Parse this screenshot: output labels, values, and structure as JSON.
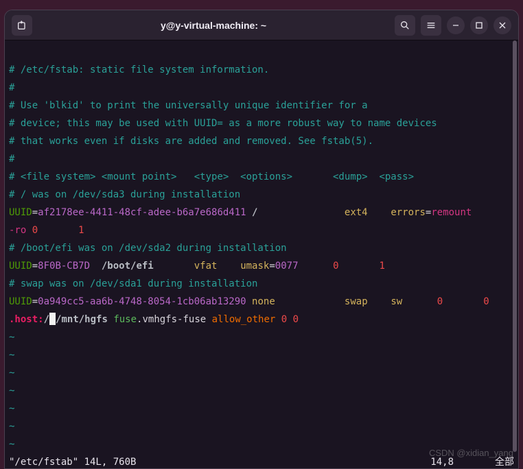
{
  "titlebar": {
    "title": "y@y-virtual-machine: ~"
  },
  "file": {
    "lines": [
      {
        "type": "comment",
        "text": "# /etc/fstab: static file system information."
      },
      {
        "type": "comment",
        "text": "#"
      },
      {
        "type": "comment",
        "text": "# Use 'blkid' to print the universally unique identifier for a"
      },
      {
        "type": "comment",
        "text": "# device; this may be used with UUID= as a more robust way to name devices"
      },
      {
        "type": "comment",
        "text": "# that works even if disks are added and removed. See fstab(5)."
      },
      {
        "type": "comment",
        "text": "#"
      },
      {
        "type": "comment",
        "text": "# <file system> <mount point>   <type>  <options>       <dump>  <pass>"
      },
      {
        "type": "comment",
        "text": "# / was on /dev/sda3 during installation"
      }
    ],
    "entry1": {
      "key": "UUID",
      "eq": "=",
      "uuid": "af2178ee-4411-48cf-adee-b6a7e686d411",
      "mount": " /",
      "type": "ext4",
      "opt1": "errors",
      "opt_eq": "=",
      "opt2": "remount",
      "wrap1": "-ro ",
      "n0": "0",
      "gap": "       ",
      "n1": "1"
    },
    "comment_boot": "# /boot/efi was on /dev/sda2 during installation",
    "entry2": {
      "key": "UUID",
      "eq": "=",
      "uuid": "8F0B-CB7D",
      "mount": "  /boot/efi",
      "type": "vfat",
      "opt": "umask",
      "opt_eq": "=",
      "opt_val": "0077",
      "n0": "0",
      "n1": "1"
    },
    "comment_swap": "# swap was on /dev/sda1 during installation",
    "entry3": {
      "key": "UUID",
      "eq": "=",
      "uuid": "0a949cc5-aa6b-4748-8054-1cb06ab13290",
      "type": "none",
      "swap": "swap",
      "sw": "sw",
      "n0": "0",
      "n1": "0"
    },
    "entry4": {
      "host": ".host:",
      "slash": "/",
      "path": "/mnt/hgfs ",
      "fuse": "fuse",
      "rest": ".vmhgfs-fuse ",
      "allow": "allow_other",
      "n0": " 0",
      "n1": " 0"
    }
  },
  "tilde": "~",
  "status": {
    "left": "\"/etc/fstab\" 14L, 760B",
    "pos": "14,8",
    "mode": "全部"
  },
  "watermark": "CSDN @xidian_yang"
}
